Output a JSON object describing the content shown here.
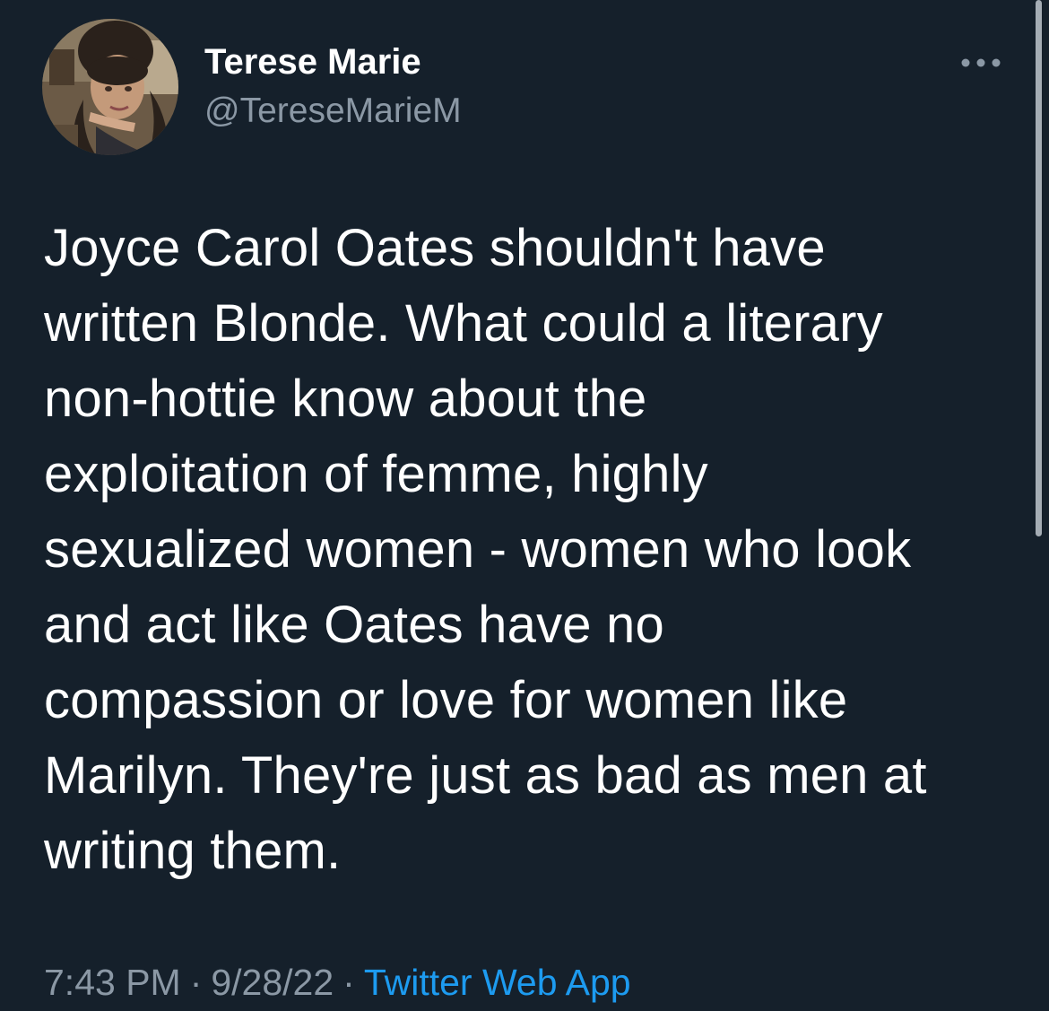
{
  "tweet": {
    "author": {
      "display_name": "Terese Marie",
      "handle": "@TereseMarieM",
      "avatar_icon": "profile-photo"
    },
    "more_icon": "more-options-icon",
    "text": "Joyce Carol Oates shouldn't have\nwritten Blonde. What could a literary\nnon-hottie know about the\nexploitation of femme, highly\nsexualized women - women who look\nand act like Oates have no\ncompassion or love for women like\nMarilyn. They're just as bad as men at\nwriting them.",
    "time": "7:43 PM",
    "separator": "·",
    "date": "9/28/22",
    "source": "Twitter Web App"
  },
  "colors": {
    "background": "#15202b",
    "text_primary": "#ffffff",
    "text_secondary": "#8b98a5",
    "accent": "#1d9bf0"
  }
}
